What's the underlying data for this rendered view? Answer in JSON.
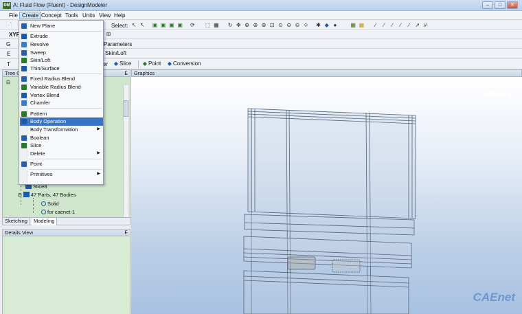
{
  "window": {
    "title": "A: Fluid Flow (Fluent) - DesignModeler",
    "app_icon_text": "DM"
  },
  "menubar": [
    "File",
    "Create",
    "Concept",
    "Tools",
    "Units",
    "View",
    "Help"
  ],
  "toolbar1": {
    "select_label": "Select:"
  },
  "toolbar2": {
    "parameters_label": "Parameters"
  },
  "toolbar3": {
    "skin_loft_label": "Skin/Loft"
  },
  "toolbar4": {
    "er_label": "er",
    "slice_label": "Slice",
    "point_label": "Point",
    "conversion_label": "Conversion"
  },
  "left_toolbar_fragments": {
    "xyplane": "XYP",
    "g": "G",
    "e": "E",
    "t": "T"
  },
  "create_menu": {
    "items": [
      {
        "label": "New Plane",
        "icon": "new-plane-icon",
        "submenu": false
      },
      {
        "sep": true
      },
      {
        "label": "Extrude",
        "icon": "extrude-icon",
        "submenu": false
      },
      {
        "label": "Revolve",
        "icon": "revolve-icon",
        "submenu": false
      },
      {
        "label": "Sweep",
        "icon": "sweep-icon",
        "submenu": false
      },
      {
        "label": "Skin/Loft",
        "icon": "skin-loft-icon",
        "submenu": false
      },
      {
        "label": "Thin/Surface",
        "icon": "thin-surface-icon",
        "submenu": false
      },
      {
        "sep": true
      },
      {
        "label": "Fixed Radius Blend",
        "icon": "fixed-radius-blend-icon",
        "submenu": false
      },
      {
        "label": "Variable Radius Blend",
        "icon": "variable-radius-blend-icon",
        "submenu": false
      },
      {
        "label": "Vertex Blend",
        "icon": "vertex-blend-icon",
        "submenu": false
      },
      {
        "label": "Chamfer",
        "icon": "chamfer-icon",
        "submenu": false
      },
      {
        "sep": true
      },
      {
        "label": "Pattern",
        "icon": "pattern-icon",
        "submenu": false
      },
      {
        "label": "Body Operation",
        "icon": "body-operation-icon",
        "submenu": false,
        "highlighted": true
      },
      {
        "label": "Body Transformation",
        "icon": "",
        "submenu": true
      },
      {
        "label": "Boolean",
        "icon": "boolean-icon",
        "submenu": false
      },
      {
        "label": "Slice",
        "icon": "slice-icon",
        "submenu": false
      },
      {
        "label": "Delete",
        "icon": "",
        "submenu": true
      },
      {
        "sep": true
      },
      {
        "label": "Point",
        "icon": "point-icon",
        "submenu": false
      },
      {
        "sep": true
      },
      {
        "label": "Primitives",
        "icon": "",
        "submenu": true
      }
    ]
  },
  "tree": {
    "header": "Tree Outline",
    "rows": [
      {
        "label": "Slice8",
        "indent": 2
      },
      {
        "label": "47 Parts, 47 Bodies",
        "indent": 1
      },
      {
        "label": "Solid",
        "indent": 3
      },
      {
        "label": "for caenet-1",
        "indent": 3
      }
    ]
  },
  "tabs": {
    "sketching": "Sketching",
    "modeling": "Modeling"
  },
  "details": {
    "header": "Details View"
  },
  "graphics": {
    "header": "Graphics",
    "logo": "ANSYS",
    "version": "R15.0",
    "watermark": "CAEnet"
  },
  "colors": {
    "tree_bg": "#cfe6cc",
    "menu_highlight": "#3874c5",
    "viewport_bottom": "#a8c2e2"
  }
}
